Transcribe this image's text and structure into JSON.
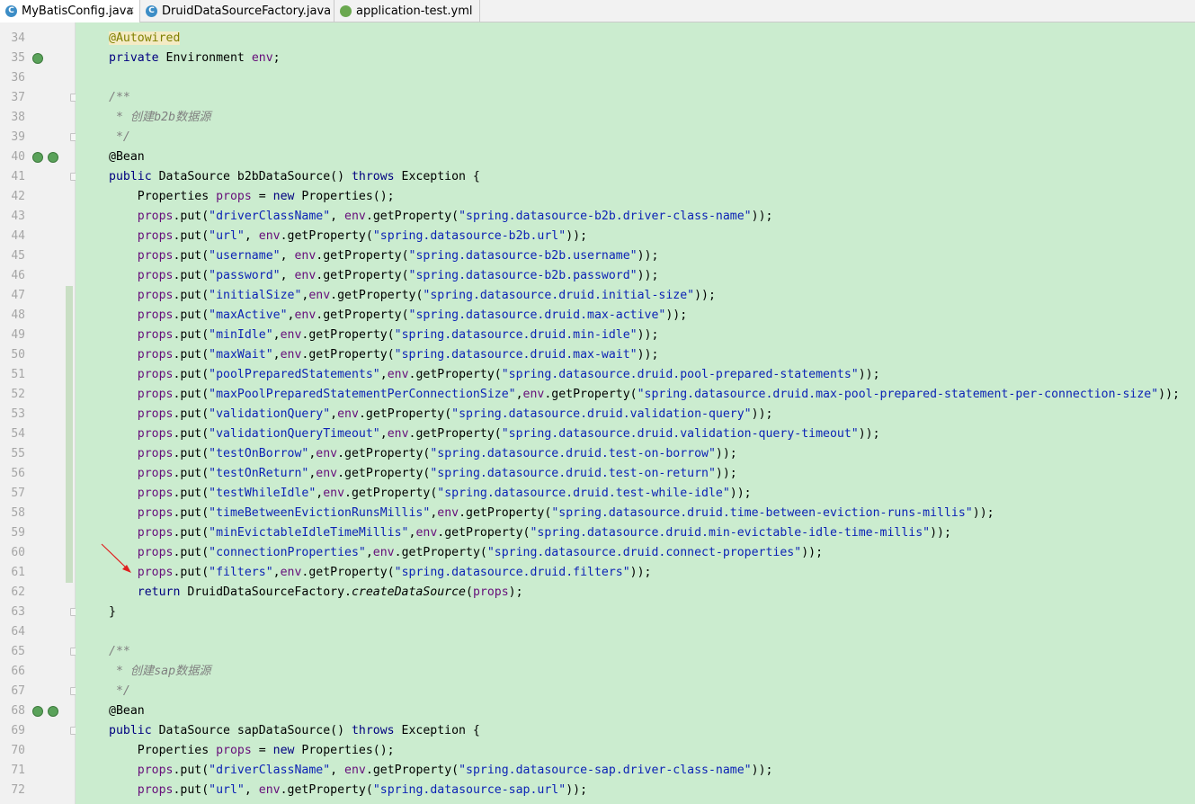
{
  "tabs": [
    {
      "label": "MyBatisConfig.java",
      "icon": "java-class-icon",
      "active": true,
      "close": "✕"
    },
    {
      "label": "DruidDataSourceFactory.java",
      "icon": "java-class-icon",
      "active": false
    },
    {
      "label": "application-test.yml",
      "icon": "spring-yml-icon",
      "active": false
    }
  ],
  "line_numbers": [
    "34",
    "35",
    "36",
    "37",
    "38",
    "39",
    "40",
    "41",
    "42",
    "43",
    "44",
    "45",
    "46",
    "47",
    "48",
    "49",
    "50",
    "51",
    "52",
    "53",
    "54",
    "55",
    "56",
    "57",
    "58",
    "59",
    "60",
    "61",
    "62",
    "63",
    "64",
    "65",
    "66",
    "67",
    "68",
    "69",
    "70",
    "71",
    "72"
  ],
  "code": {
    "l34": "@Autowired",
    "l35_a": "private ",
    "l35_b": "Environment ",
    "l35_c": "env",
    "l35_d": ";",
    "l37": "/**",
    "l38": " * 创建b2b数据源",
    "l39": " */",
    "l40": "@Bean",
    "l41_a": "public ",
    "l41_b": "DataSource b2bDataSource() ",
    "l41_c": "throws ",
    "l41_d": "Exception {",
    "l42_a": "    Properties ",
    "l42_b": "props",
    "l42_c": " = ",
    "l42_d": "new ",
    "l42_e": "Properties();",
    "puts": [
      {
        "key": "\"driverClassName\"",
        "sep": ", ",
        "val": "\"spring.datasource-b2b.driver-class-name\""
      },
      {
        "key": "\"url\"",
        "sep": ", ",
        "val": "\"spring.datasource-b2b.url\""
      },
      {
        "key": "\"username\"",
        "sep": ", ",
        "val": "\"spring.datasource-b2b.username\""
      },
      {
        "key": "\"password\"",
        "sep": ", ",
        "val": "\"spring.datasource-b2b.password\""
      },
      {
        "key": "\"initialSize\"",
        "sep": ",",
        "val": "\"spring.datasource.druid.initial-size\""
      },
      {
        "key": "\"maxActive\"",
        "sep": ",",
        "val": "\"spring.datasource.druid.max-active\""
      },
      {
        "key": "\"minIdle\"",
        "sep": ",",
        "val": "\"spring.datasource.druid.min-idle\""
      },
      {
        "key": "\"maxWait\"",
        "sep": ",",
        "val": "\"spring.datasource.druid.max-wait\""
      },
      {
        "key": "\"poolPreparedStatements\"",
        "sep": ",",
        "val": "\"spring.datasource.druid.pool-prepared-statements\""
      },
      {
        "key": "\"maxPoolPreparedStatementPerConnectionSize\"",
        "sep": ",",
        "val": "\"spring.datasource.druid.max-pool-prepared-statement-per-connection-size\""
      },
      {
        "key": "\"validationQuery\"",
        "sep": ",",
        "val": "\"spring.datasource.druid.validation-query\""
      },
      {
        "key": "\"validationQueryTimeout\"",
        "sep": ",",
        "val": "\"spring.datasource.druid.validation-query-timeout\""
      },
      {
        "key": "\"testOnBorrow\"",
        "sep": ",",
        "val": "\"spring.datasource.druid.test-on-borrow\""
      },
      {
        "key": "\"testOnReturn\"",
        "sep": ",",
        "val": "\"spring.datasource.druid.test-on-return\""
      },
      {
        "key": "\"testWhileIdle\"",
        "sep": ",",
        "val": "\"spring.datasource.druid.test-while-idle\""
      },
      {
        "key": "\"timeBetweenEvictionRunsMillis\"",
        "sep": ",",
        "val": "\"spring.datasource.druid.time-between-eviction-runs-millis\""
      },
      {
        "key": "\"minEvictableIdleTimeMillis\"",
        "sep": ",",
        "val": "\"spring.datasource.druid.min-evictable-idle-time-millis\""
      },
      {
        "key": "\"connectionProperties\"",
        "sep": ",",
        "val": "\"spring.datasource.druid.connect-properties\""
      },
      {
        "key": "\"filters\"",
        "sep": ",",
        "val": "\"spring.datasource.druid.filters\""
      }
    ],
    "put_prefix": "props",
    "put_call": ".put(",
    "env": "env",
    "getprop": ".getProperty(",
    "put_end": "));",
    "l62_a": "    ",
    "l62_b": "return ",
    "l62_c": "DruidDataSourceFactory.",
    "l62_d": "createDataSource",
    "l62_e": "(",
    "l62_f": "props",
    "l62_g": ");",
    "l63": "}",
    "l65": "/**",
    "l66": " * 创建sap数据源",
    "l67": " */",
    "l68": "@Bean",
    "l69_a": "public ",
    "l69_b": "DataSource sapDataSource() ",
    "l69_c": "throws ",
    "l69_d": "Exception {",
    "l70_a": "    Properties ",
    "l70_b": "props",
    "l70_c": " = ",
    "l70_d": "new ",
    "l70_e": "Properties();",
    "sap_puts": [
      {
        "key": "\"driverClassName\"",
        "sep": ", ",
        "val": "\"spring.datasource-sap.driver-class-name\""
      },
      {
        "key": "\"url\"",
        "sep": ", ",
        "val": "\"spring.datasource-sap.url\""
      }
    ]
  },
  "colors": {
    "editor_bg": "#cbeccf",
    "keyword": "#000080",
    "string": "#0d23b5",
    "field": "#660e7a",
    "comment": "#808080",
    "annotation": "#808000",
    "arrow": "#e02020"
  }
}
